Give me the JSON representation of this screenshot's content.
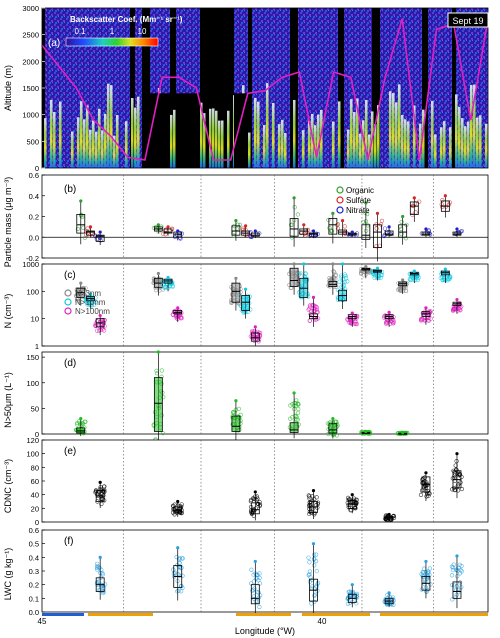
{
  "figure": {
    "xlabel": "Longitude (°W)",
    "x_tick_labels": [
      "45",
      "40"
    ],
    "date_label": "Sept 19"
  },
  "colors": {
    "organic": "#2ca02c",
    "sulfate": "#d62728",
    "nitrate": "#1f1fd0",
    "n3": "#888888",
    "n10": "#10c8e0",
    "n100": "#e020c0",
    "supermicron": "#22bb22",
    "cdnc": "#000000",
    "lwc": "#2aa0e0",
    "flight_altitude": "#e020c0",
    "bar_blue": "#1f5fd0",
    "bar_orange": "#f0a000"
  },
  "chart_data": [
    {
      "panel": "(a)",
      "type": "heatmap",
      "ylabel": "Altitude (m)",
      "ylim": [
        0,
        3000
      ],
      "yticks": [
        0,
        500,
        1000,
        1500,
        2000,
        2500,
        3000
      ],
      "colorbar": {
        "title": "Backscatter Coef. (Mm⁻¹ sr⁻¹)",
        "ticks": [
          "0.1",
          "1",
          "10"
        ],
        "log": true
      },
      "flight_altitude_m": [
        2300,
        1900,
        1500,
        900,
        600,
        200,
        150,
        1700,
        1700,
        1500,
        150,
        150,
        1400,
        1450,
        1700,
        1800,
        200,
        1800,
        1700,
        150,
        1700,
        2800,
        150,
        2600,
        2700,
        900,
        2800
      ]
    },
    {
      "panel": "(b)",
      "type": "box",
      "ylabel": "Particle mass (μg m⁻³)",
      "ylim": [
        -0.2,
        0.6
      ],
      "yticks": [
        "-0.2",
        "0.0",
        "0.2",
        "0.4",
        "0.6"
      ],
      "legend": [
        "Organic",
        "Sulfate",
        "Nitrate"
      ],
      "series": [
        {
          "name": "Organic",
          "boxes": [
            [
              1,
              0.04,
              0.22,
              0.12,
              0.35
            ],
            [
              3,
              0.06,
              0.1,
              0.08,
              0.12
            ],
            [
              5,
              0.02,
              0.11,
              0.06,
              0.16
            ],
            [
              6.5,
              0.01,
              0.18,
              0.08,
              0.38
            ],
            [
              7.5,
              0.03,
              0.18,
              0.12,
              0.23
            ],
            [
              8.35,
              -0.02,
              0.12,
              0.02,
              0.33
            ],
            [
              9.3,
              0.0,
              0.12,
              0.05,
              0.2
            ]
          ]
        },
        {
          "name": "Sulfate",
          "boxes": [
            [
              1.25,
              0.02,
              0.06,
              0.05,
              0.1
            ],
            [
              3.25,
              0.04,
              0.08,
              0.05,
              0.1
            ],
            [
              5.25,
              0.02,
              0.06,
              0.04,
              0.11
            ],
            [
              6.75,
              0.03,
              0.08,
              0.06,
              0.12
            ],
            [
              7.75,
              0.03,
              0.07,
              0.05,
              0.16
            ],
            [
              8.65,
              -0.1,
              0.12,
              0.05,
              0.23
            ],
            [
              9.6,
              0.22,
              0.34,
              0.3,
              0.38
            ],
            [
              10.4,
              0.25,
              0.35,
              0.3,
              0.4
            ]
          ]
        },
        {
          "name": "Nitrate",
          "boxes": [
            [
              1.5,
              -0.04,
              0.02,
              0.01,
              0.05
            ],
            [
              3.5,
              0.0,
              0.05,
              0.03,
              0.06
            ],
            [
              5.5,
              0.01,
              0.04,
              0.02,
              0.06
            ],
            [
              7.0,
              0.01,
              0.04,
              0.03,
              0.06
            ],
            [
              8.0,
              0.02,
              0.04,
              0.03,
              0.05
            ],
            [
              8.95,
              0.02,
              0.06,
              0.03,
              0.1
            ],
            [
              9.9,
              0.02,
              0.05,
              0.03,
              0.08
            ],
            [
              10.7,
              0.02,
              0.05,
              0.03,
              0.08
            ]
          ]
        }
      ]
    },
    {
      "panel": "(c)",
      "type": "box",
      "ylabel": "N (cm⁻³)",
      "ylog": true,
      "ylim": [
        1,
        1000
      ],
      "ytick_labels": [
        "1",
        "10",
        "100",
        "1000"
      ],
      "legend": [
        "N>3nm",
        "N>10nm",
        "N>100nm"
      ],
      "series": [
        {
          "name": "N>3nm",
          "boxes": [
            [
              1.0,
              60,
              130,
              90,
              200
            ],
            [
              3.0,
              140,
              300,
              200,
              450
            ],
            [
              5.0,
              40,
              200,
              100,
              300
            ],
            [
              6.5,
              150,
              700,
              250,
              1000
            ],
            [
              7.5,
              150,
              230,
              180,
              1000
            ],
            [
              8.35,
              600,
              700,
              650,
              800
            ],
            [
              9.3,
              160,
              220,
              190,
              260
            ]
          ]
        },
        {
          "name": "N>10nm",
          "boxes": [
            [
              1.25,
              45,
              65,
              55,
              80
            ],
            [
              3.25,
              200,
              280,
              240,
              320
            ],
            [
              5.25,
              20,
              70,
              40,
              120
            ],
            [
              6.75,
              60,
              300,
              130,
              1000
            ],
            [
              7.75,
              45,
              110,
              70,
              1000
            ],
            [
              8.65,
              500,
              600,
              550,
              700
            ],
            [
              9.6,
              400,
              500,
              450,
              550
            ],
            [
              10.4,
              400,
              550,
              480,
              650
            ]
          ]
        },
        {
          "name": "N>100nm",
          "boxes": [
            [
              1.5,
              5,
              10,
              7,
              13
            ],
            [
              3.5,
              15,
              20,
              17,
              25
            ],
            [
              5.5,
              1.5,
              3,
              2,
              5
            ],
            [
              7.0,
              10,
              15,
              12,
              60
            ],
            [
              8.0,
              10,
              14,
              12,
              16
            ],
            [
              8.95,
              10,
              14,
              12,
              17
            ],
            [
              9.9,
              12,
              18,
              15,
              25
            ],
            [
              10.7,
              30,
              40,
              35,
              50
            ]
          ]
        }
      ]
    },
    {
      "panel": "(d)",
      "type": "box",
      "ylabel": "N>50μm (L⁻¹)",
      "ylim": [
        0,
        160
      ],
      "yticks": [
        "0",
        "50",
        "100",
        "150"
      ],
      "series": [
        {
          "name": "N>50μm",
          "boxes": [
            [
              1.0,
              2,
              12,
              6,
              30
            ],
            [
              3.0,
              5,
              110,
              60,
              160
            ],
            [
              5.0,
              5,
              35,
              15,
              65
            ],
            [
              6.5,
              3,
              22,
              8,
              80
            ],
            [
              7.5,
              2,
              20,
              8,
              30
            ],
            [
              8.35,
              1,
              3,
              2,
              5
            ],
            [
              9.3,
              0.5,
              1.5,
              1,
              3
            ]
          ]
        }
      ]
    },
    {
      "panel": "(e)",
      "type": "box",
      "ylabel": "CDNC (cm⁻³)",
      "ylim": [
        0,
        120
      ],
      "yticks": [
        "0",
        "20",
        "40",
        "60",
        "80",
        "100",
        "120"
      ],
      "series": [
        {
          "name": "CDNC",
          "boxes": [
            [
              1.5,
              30,
              46,
              38,
              58
            ],
            [
              3.5,
              13,
              22,
              17,
              30
            ],
            [
              5.5,
              12,
              28,
              18,
              44
            ],
            [
              7.0,
              14,
              30,
              22,
              46
            ],
            [
              8.0,
              20,
              32,
              26,
              40
            ],
            [
              8.95,
              4,
              8,
              6,
              11
            ],
            [
              9.9,
              44,
              66,
              55,
              72
            ],
            [
              10.7,
              50,
              75,
              62,
              100
            ]
          ]
        }
      ]
    },
    {
      "panel": "(f)",
      "type": "box",
      "ylabel": "LWC (g kg⁻¹)",
      "ylim": [
        0,
        0.6
      ],
      "yticks": [
        "0.0",
        "0.1",
        "0.2",
        "0.3",
        "0.4",
        "0.5",
        "0.6"
      ],
      "series": [
        {
          "name": "LWC",
          "boxes": [
            [
              1.5,
              0.15,
              0.25,
              0.2,
              0.4
            ],
            [
              3.5,
              0.18,
              0.34,
              0.26,
              0.47
            ],
            [
              5.5,
              0.06,
              0.2,
              0.1,
              0.37
            ],
            [
              7.0,
              0.08,
              0.24,
              0.16,
              0.5
            ],
            [
              8.0,
              0.07,
              0.13,
              0.1,
              0.2
            ],
            [
              8.95,
              0.06,
              0.1,
              0.08,
              0.14
            ],
            [
              9.9,
              0.16,
              0.26,
              0.21,
              0.37
            ],
            [
              10.7,
              0.1,
              0.22,
              0.15,
              0.41
            ]
          ]
        }
      ]
    }
  ]
}
